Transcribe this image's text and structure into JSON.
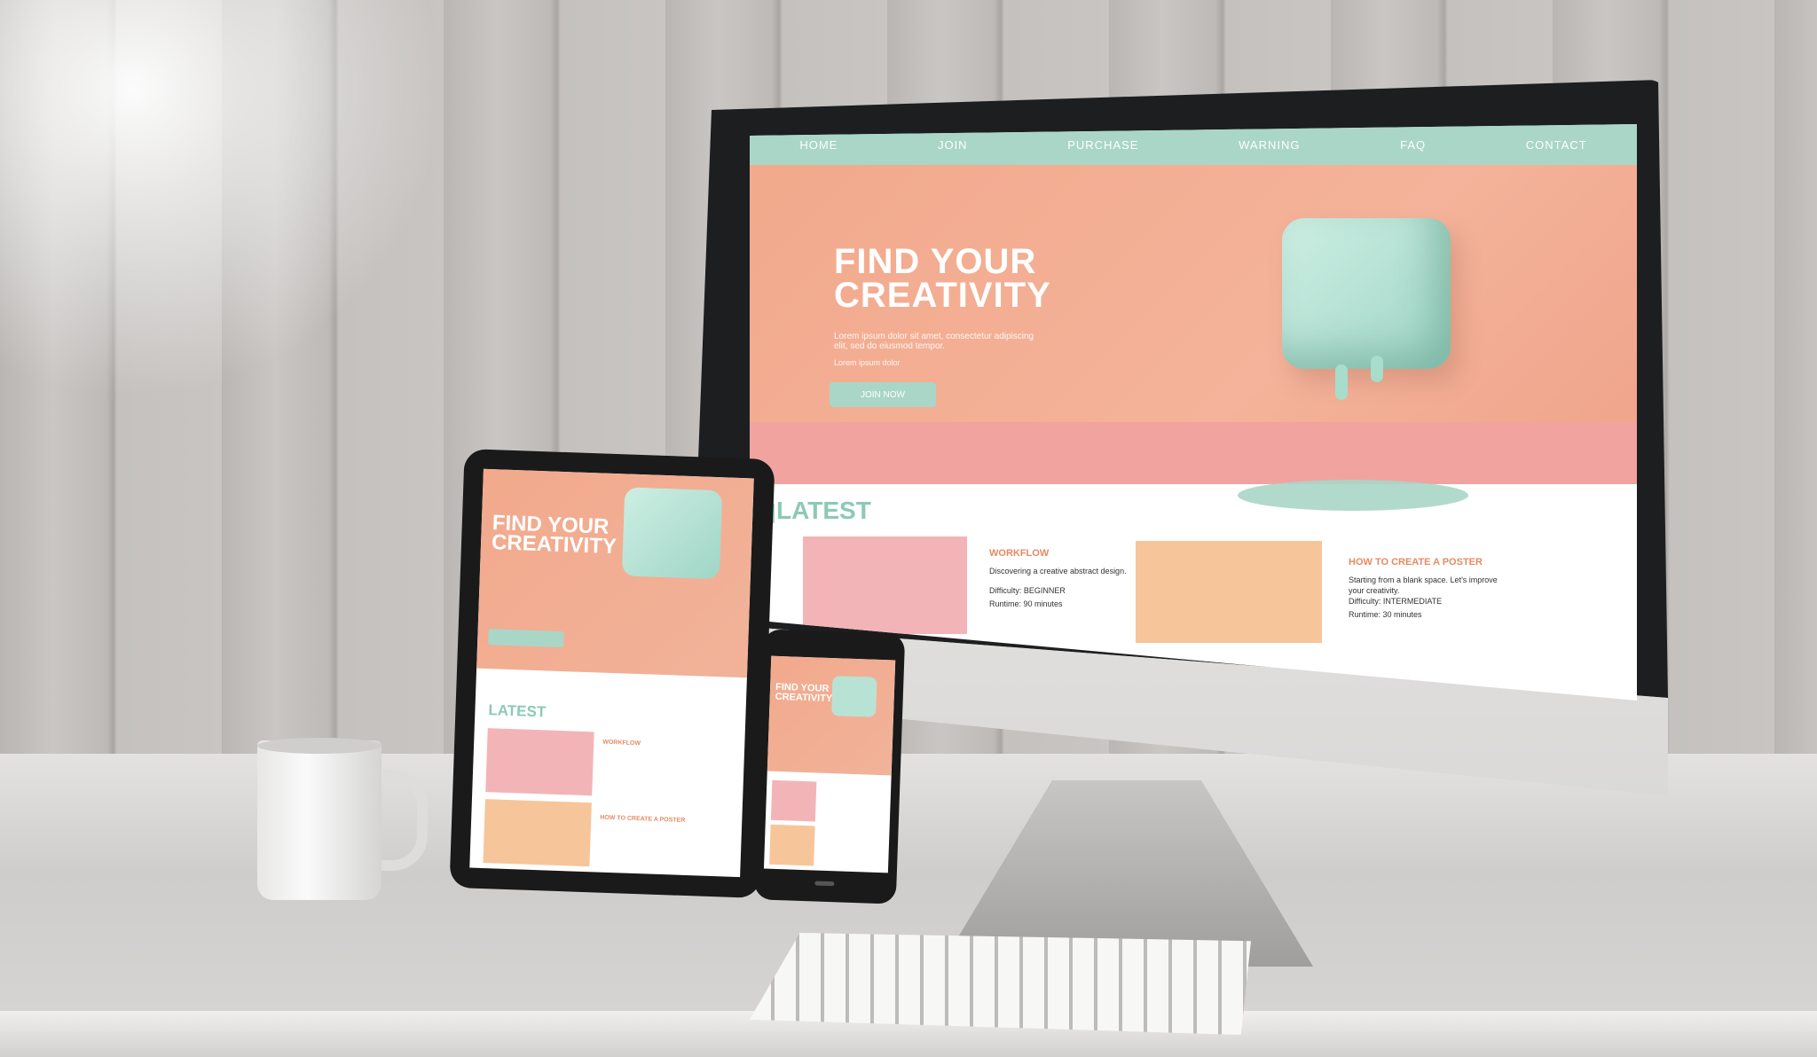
{
  "monitor": {
    "nav": [
      "HOME",
      "JOIN",
      "PURCHASE",
      "WARNING",
      "FAQ",
      "CONTACT"
    ],
    "hero_title_line1": "FIND YOUR",
    "hero_title_line2": "CREATIVITY",
    "hero_subtitle": "Lorem ipsum dolor sit amet, consectetur adipiscing elit, sed do eiusmod tempor.",
    "hero_small": "Lorem ipsum dolor",
    "hero_button": "JOIN NOW",
    "latest_label": "LATEST",
    "cards": [
      {
        "title": "WORKFLOW",
        "text": "Discovering a creative abstract design.",
        "meta1": "Difficulty: BEGINNER",
        "meta2": "Runtime: 90 minutes"
      },
      {
        "title": "HOW TO CREATE A POSTER",
        "text": "Starting from a blank space. Let's improve your creativity.",
        "meta1": "Difficulty: INTERMEDIATE",
        "meta2": "Runtime: 30 minutes"
      }
    ]
  },
  "tablet": {
    "hero_title_line1": "FIND YOUR",
    "hero_title_line2": "CREATIVITY",
    "latest_label": "LATEST",
    "card1_title": "WORKFLOW",
    "card2_title": "HOW TO CREATE A POSTER"
  },
  "phone": {
    "hero_title_line1": "FIND YOUR",
    "hero_title_line2": "CREATIVITY"
  },
  "colors": {
    "mint": "#a9d6c7",
    "peach": "#f2a98c",
    "pink": "#f1a3a0",
    "orange_text": "#e58a63"
  }
}
